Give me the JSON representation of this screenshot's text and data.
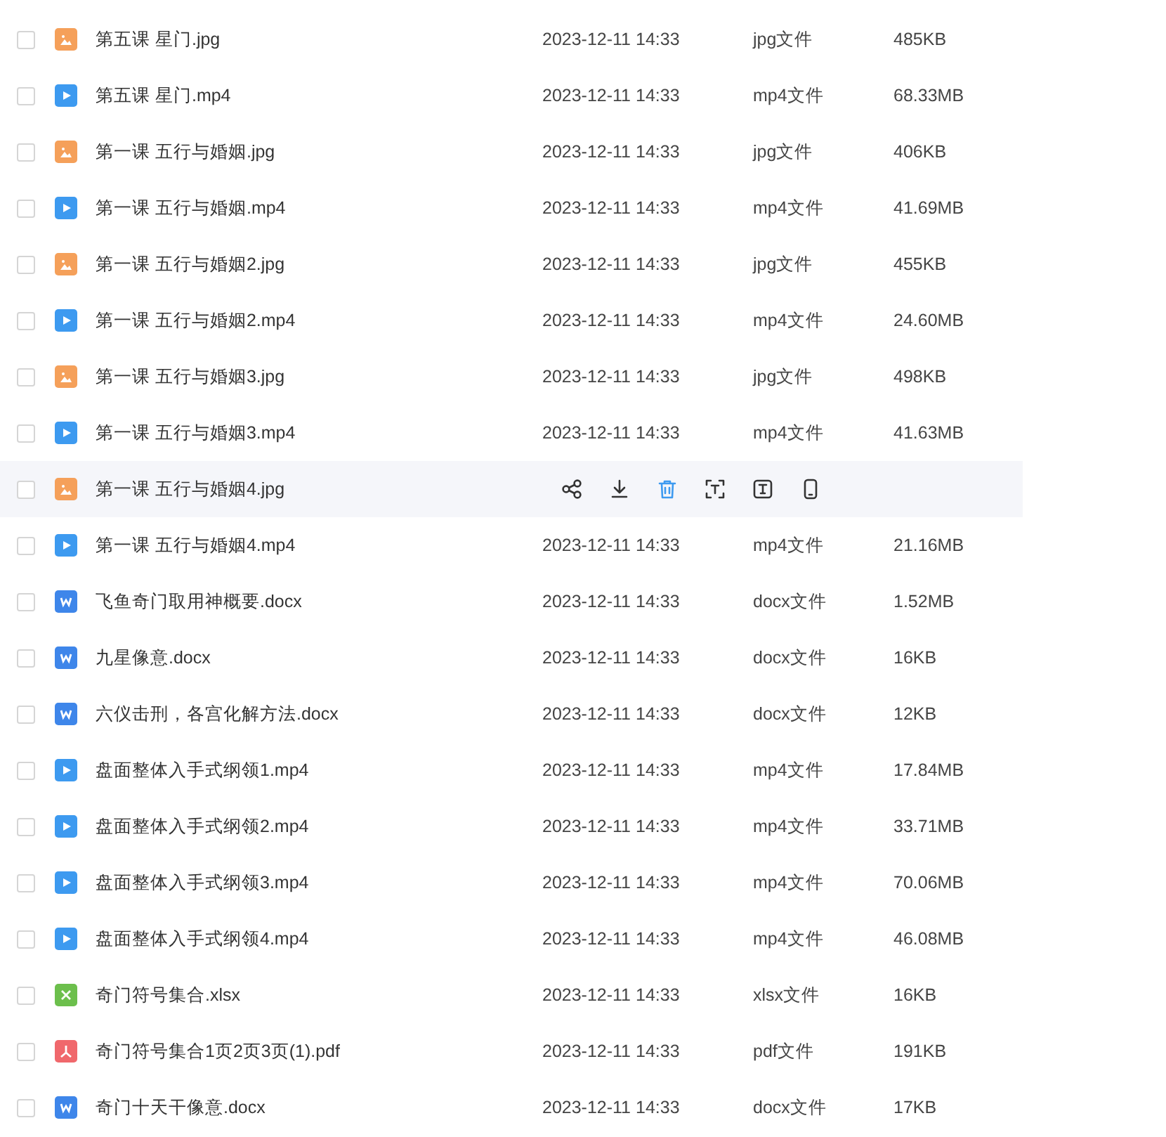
{
  "files": [
    {
      "kind": "jpg",
      "name": "第五课 星门.jpg",
      "checked": false,
      "hovered": false,
      "modified": "2023-12-11 14:33",
      "type": "jpg文件",
      "size": "485KB"
    },
    {
      "kind": "mp4",
      "name": "第五课 星门.mp4",
      "checked": false,
      "hovered": false,
      "modified": "2023-12-11 14:33",
      "type": "mp4文件",
      "size": "68.33MB"
    },
    {
      "kind": "jpg",
      "name": "第一课 五行与婚姻.jpg",
      "checked": false,
      "hovered": false,
      "modified": "2023-12-11 14:33",
      "type": "jpg文件",
      "size": "406KB"
    },
    {
      "kind": "mp4",
      "name": "第一课 五行与婚姻.mp4",
      "checked": false,
      "hovered": false,
      "modified": "2023-12-11 14:33",
      "type": "mp4文件",
      "size": "41.69MB"
    },
    {
      "kind": "jpg",
      "name": "第一课 五行与婚姻2.jpg",
      "checked": false,
      "hovered": false,
      "modified": "2023-12-11 14:33",
      "type": "jpg文件",
      "size": "455KB"
    },
    {
      "kind": "mp4",
      "name": "第一课 五行与婚姻2.mp4",
      "checked": false,
      "hovered": false,
      "modified": "2023-12-11 14:33",
      "type": "mp4文件",
      "size": "24.60MB"
    },
    {
      "kind": "jpg",
      "name": "第一课 五行与婚姻3.jpg",
      "checked": false,
      "hovered": false,
      "modified": "2023-12-11 14:33",
      "type": "jpg文件",
      "size": "498KB"
    },
    {
      "kind": "mp4",
      "name": "第一课 五行与婚姻3.mp4",
      "checked": false,
      "hovered": false,
      "modified": "2023-12-11 14:33",
      "type": "mp4文件",
      "size": "41.63MB"
    },
    {
      "kind": "jpg",
      "name": "第一课 五行与婚姻4.jpg",
      "checked": false,
      "hovered": true
    },
    {
      "kind": "mp4",
      "name": "第一课 五行与婚姻4.mp4",
      "checked": false,
      "hovered": false,
      "modified": "2023-12-11 14:33",
      "type": "mp4文件",
      "size": "21.16MB"
    },
    {
      "kind": "docx",
      "name": "飞鱼奇门取用神概要.docx",
      "checked": false,
      "hovered": false,
      "modified": "2023-12-11 14:33",
      "type": "docx文件",
      "size": "1.52MB"
    },
    {
      "kind": "docx",
      "name": "九星像意.docx",
      "checked": false,
      "hovered": false,
      "modified": "2023-12-11 14:33",
      "type": "docx文件",
      "size": "16KB"
    },
    {
      "kind": "docx",
      "name": "六仪击刑，各宫化解方法.docx",
      "checked": false,
      "hovered": false,
      "modified": "2023-12-11 14:33",
      "type": "docx文件",
      "size": "12KB"
    },
    {
      "kind": "mp4",
      "name": "盘面整体入手式纲领1.mp4",
      "checked": false,
      "hovered": false,
      "modified": "2023-12-11 14:33",
      "type": "mp4文件",
      "size": "17.84MB"
    },
    {
      "kind": "mp4",
      "name": "盘面整体入手式纲领2.mp4",
      "checked": false,
      "hovered": false,
      "modified": "2023-12-11 14:33",
      "type": "mp4文件",
      "size": "33.71MB"
    },
    {
      "kind": "mp4",
      "name": "盘面整体入手式纲领3.mp4",
      "checked": false,
      "hovered": false,
      "modified": "2023-12-11 14:33",
      "type": "mp4文件",
      "size": "70.06MB"
    },
    {
      "kind": "mp4",
      "name": "盘面整体入手式纲领4.mp4",
      "checked": false,
      "hovered": false,
      "modified": "2023-12-11 14:33",
      "type": "mp4文件",
      "size": "46.08MB"
    },
    {
      "kind": "xlsx",
      "name": "奇门符号集合.xlsx",
      "checked": false,
      "hovered": false,
      "modified": "2023-12-11 14:33",
      "type": "xlsx文件",
      "size": "16KB"
    },
    {
      "kind": "pdf",
      "name": "奇门符号集合1页2页3页(1).pdf",
      "checked": false,
      "hovered": false,
      "modified": "2023-12-11 14:33",
      "type": "pdf文件",
      "size": "191KB"
    },
    {
      "kind": "docx",
      "name": "奇门十天干像意.docx",
      "checked": false,
      "hovered": false,
      "modified": "2023-12-11 14:33",
      "type": "docx文件",
      "size": "17KB"
    }
  ]
}
